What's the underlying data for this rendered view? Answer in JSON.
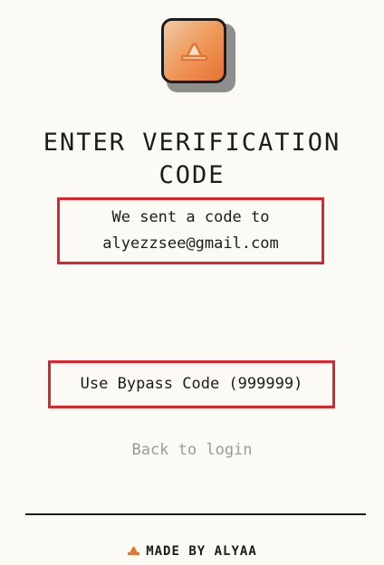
{
  "logo": {
    "icon": "orange-hat-icon",
    "accent_color": "#e8722f"
  },
  "title": {
    "line1": "ENTER VERIFICATION",
    "line2": "CODE"
  },
  "message": {
    "line1": "We sent a code to",
    "email": "alyezzsee@gmail.com"
  },
  "bypass": {
    "label": "Use Bypass Code (999999)"
  },
  "back": {
    "label": "Back to login"
  },
  "footer": {
    "icon": "orange-hat-icon",
    "label": "MADE BY ALYAA"
  },
  "colors": {
    "background": "#fbfaf5",
    "text": "#1c1c1c",
    "highlight_border": "#e0242b",
    "muted": "#9a9a9a"
  }
}
